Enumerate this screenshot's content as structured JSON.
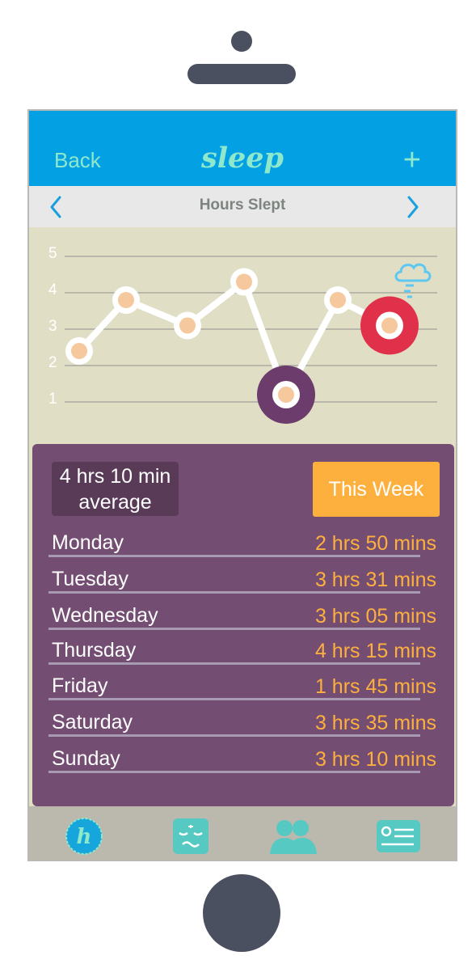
{
  "app": {
    "back_label": "Back",
    "logo": "sleep",
    "add_label": "+"
  },
  "chart_header": {
    "title": "Hours Slept"
  },
  "chart_data": {
    "type": "line",
    "title": "Hours Slept",
    "categories": [
      "Monday",
      "Tuesday",
      "Wednesday",
      "Thursday",
      "Friday",
      "Saturday",
      "Sunday"
    ],
    "values": [
      2.4,
      3.8,
      3.1,
      4.3,
      1.2,
      3.8,
      3.1
    ],
    "yticks": [
      "1",
      "2",
      "3",
      "4",
      "5"
    ],
    "ylim": [
      0,
      5
    ],
    "grid": true,
    "highlights": [
      {
        "index": 4,
        "color": "#6c3d6c"
      },
      {
        "index": 6,
        "color": "#e1304a"
      }
    ],
    "line_color": "#ffffff",
    "point_color": "#f5c89e",
    "background": "#e1dec6"
  },
  "summary": {
    "average_line1": "4 hrs 10 min",
    "average_line2": "average",
    "period_button": "This Week"
  },
  "days": [
    {
      "day": "Monday",
      "hours": "2 hrs 50 mins"
    },
    {
      "day": "Tuesday",
      "hours": "3 hrs 31 mins"
    },
    {
      "day": "Wednesday",
      "hours": "3 hrs 05 mins"
    },
    {
      "day": "Thursday",
      "hours": "4 hrs 15 mins"
    },
    {
      "day": "Friday",
      "hours": "1 hrs 45 mins"
    },
    {
      "day": "Saturday",
      "hours": "3 hrs 35 mins"
    },
    {
      "day": "Sunday",
      "hours": "3 hrs 10 mins"
    }
  ],
  "tabs": [
    {
      "icon": "home-h-icon"
    },
    {
      "icon": "sleep-face-icon"
    },
    {
      "icon": "people-icon"
    },
    {
      "icon": "profile-card-icon"
    }
  ],
  "colors": {
    "header": "#03a1e4",
    "accent": "#8ee8cc",
    "panel": "#744d73",
    "orange": "#fdb03e"
  }
}
